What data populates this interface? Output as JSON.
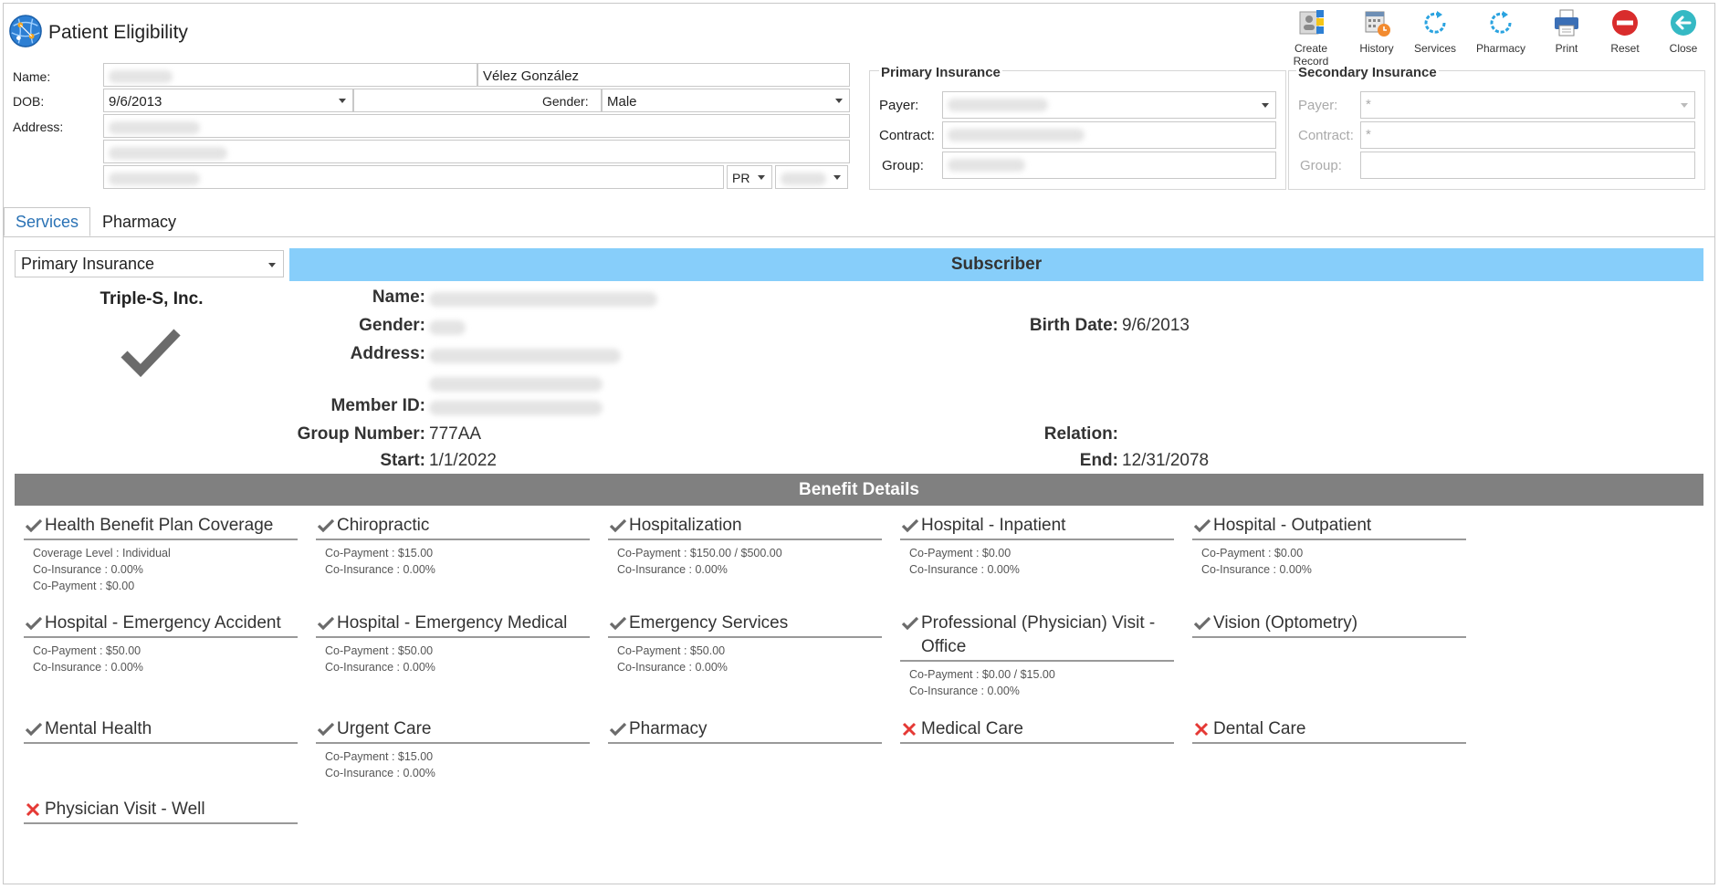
{
  "app": {
    "title": "Patient Eligibility"
  },
  "toolbar": [
    {
      "label": "Create Record",
      "icon": "create-record-icon"
    },
    {
      "label": "History",
      "icon": "history-icon"
    },
    {
      "label": "Services",
      "icon": "refresh-icon"
    },
    {
      "label": "Pharmacy",
      "icon": "refresh-icon"
    },
    {
      "label": "Print",
      "icon": "print-icon"
    },
    {
      "label": "Reset",
      "icon": "reset-icon"
    },
    {
      "label": "Close",
      "icon": "back-arrow-icon"
    }
  ],
  "patient": {
    "name_label": "Name:",
    "last_name": "Vélez González",
    "dob_label": "DOB:",
    "dob": "9/6/2013",
    "gender_label": "Gender:",
    "gender": "Male",
    "address_label": "Address:",
    "state": "PR"
  },
  "primary_insurance": {
    "title": "Primary Insurance",
    "payer_label": "Payer:",
    "contract_label": "Contract:",
    "group_label": "Group:"
  },
  "secondary_insurance": {
    "title": "Secondary Insurance",
    "payer_label": "Payer:",
    "payer_value": "*",
    "contract_label": "Contract:",
    "contract_value": "*",
    "group_label": "Group:"
  },
  "tabs": [
    {
      "label": "Services"
    },
    {
      "label": "Pharmacy"
    }
  ],
  "services": {
    "insurance_select": "Primary Insurance",
    "carrier": "Triple-S, Inc.",
    "subscriber_header": "Subscriber",
    "labels": {
      "name": "Name:",
      "gender": "Gender:",
      "address": "Address:",
      "member_id": "Member ID:",
      "group_number": "Group Number:",
      "start": "Start:",
      "birth_date": "Birth Date:",
      "relation": "Relation:",
      "end": "End:"
    },
    "values": {
      "group_number": "777AA",
      "start": "1/1/2022",
      "birth_date": "9/6/2013",
      "relation": "",
      "end": "12/31/2078"
    },
    "benefit_header": "Benefit Details",
    "benefits": [
      {
        "name": "Health Benefit Plan Coverage",
        "status": "covered",
        "details": [
          "Coverage Level : Individual",
          "Co-Insurance : 0.00%",
          "Co-Payment : $0.00"
        ]
      },
      {
        "name": "Chiropractic",
        "status": "covered",
        "details": [
          "Co-Payment : $15.00",
          "Co-Insurance : 0.00%"
        ]
      },
      {
        "name": "Hospitalization",
        "status": "covered",
        "details": [
          "Co-Payment : $150.00 / $500.00",
          "Co-Insurance : 0.00%"
        ]
      },
      {
        "name": "Hospital - Inpatient",
        "status": "covered",
        "details": [
          "Co-Payment : $0.00",
          "Co-Insurance : 0.00%"
        ]
      },
      {
        "name": "Hospital - Outpatient",
        "status": "covered",
        "details": [
          "Co-Payment : $0.00",
          "Co-Insurance : 0.00%"
        ]
      },
      {
        "name": "Hospital - Emergency Accident",
        "status": "covered",
        "details": [
          "Co-Payment : $50.00",
          "Co-Insurance : 0.00%"
        ]
      },
      {
        "name": "Hospital - Emergency Medical",
        "status": "covered",
        "details": [
          "Co-Payment : $50.00",
          "Co-Insurance : 0.00%"
        ]
      },
      {
        "name": "Emergency Services",
        "status": "covered",
        "details": [
          "Co-Payment : $50.00",
          "Co-Insurance : 0.00%"
        ]
      },
      {
        "name": "Professional (Physician) Visit - Office",
        "status": "covered",
        "details": [
          "Co-Payment : $0.00 / $15.00",
          "Co-Insurance : 0.00%"
        ]
      },
      {
        "name": "Vision (Optometry)",
        "status": "covered",
        "details": []
      },
      {
        "name": "Mental Health",
        "status": "covered",
        "details": []
      },
      {
        "name": "Urgent Care",
        "status": "covered",
        "details": [
          "Co-Payment : $15.00",
          "Co-Insurance : 0.00%"
        ]
      },
      {
        "name": "Pharmacy",
        "status": "covered",
        "details": []
      },
      {
        "name": "Medical Care",
        "status": "not-covered",
        "details": []
      },
      {
        "name": "Dental Care",
        "status": "not-covered",
        "details": []
      },
      {
        "name": "Physician Visit - Well",
        "status": "not-covered",
        "details": []
      }
    ]
  },
  "colors": {
    "subscriber_bar": "#87cefa",
    "benefit_bar": "#808080",
    "check": "#6b6b6b",
    "cross": "#e53935",
    "active_tab": "#2a72b5"
  }
}
